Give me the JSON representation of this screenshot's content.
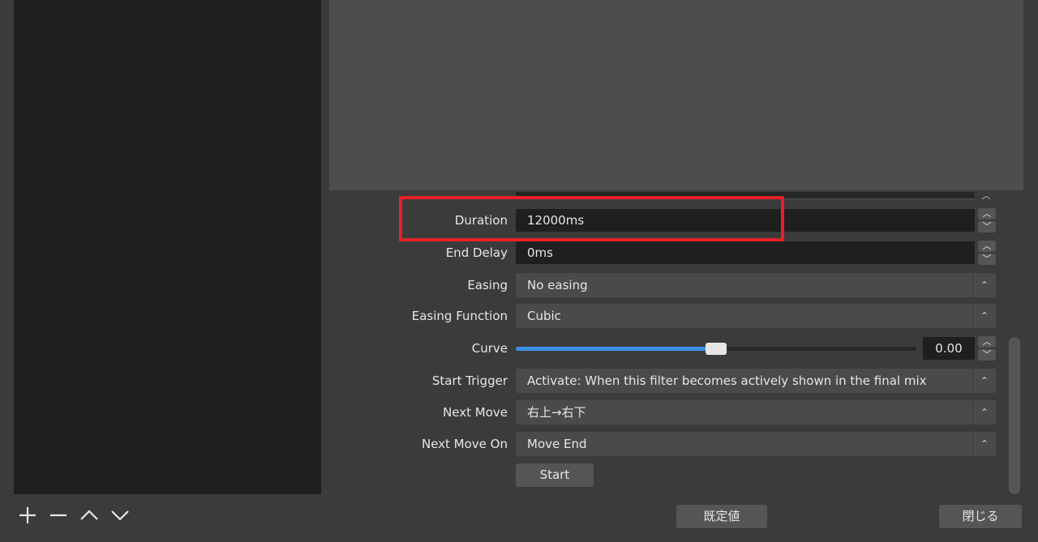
{
  "filter": {
    "duration": {
      "label": "Duration",
      "value": "12000ms"
    },
    "end_delay": {
      "label": "End Delay",
      "value": "0ms"
    },
    "easing": {
      "label": "Easing",
      "value": "No easing"
    },
    "easing_function": {
      "label": "Easing Function",
      "value": "Cubic"
    },
    "curve": {
      "label": "Curve",
      "value": "0.00",
      "slider_fraction": 0.5
    },
    "start_trigger": {
      "label": "Start Trigger",
      "value": "Activate: When this filter becomes actively shown in the final mix"
    },
    "next_move": {
      "label": "Next Move",
      "value": "右上→右下"
    },
    "next_move_on": {
      "label": "Next Move On",
      "value": "Move End"
    },
    "start_button": "Start"
  },
  "footer": {
    "defaults_button": "既定値",
    "close_button": "閉じる"
  },
  "icons": [
    "add-icon",
    "remove-icon",
    "move-up-icon",
    "move-down-icon",
    "chevron-up-icon",
    "chevron-down-icon",
    "up-down-arrows-icon"
  ],
  "colors": {
    "highlight": "#e5202b",
    "slider_fill": "#3d8fe6"
  }
}
